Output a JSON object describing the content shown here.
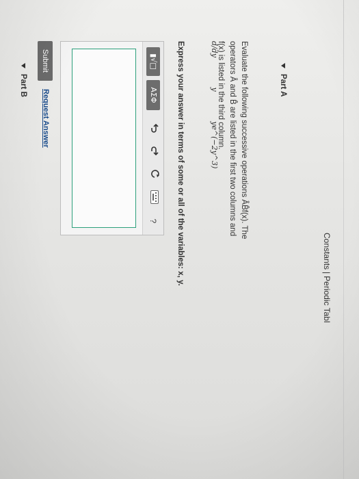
{
  "header": {
    "constants_label": "Constants",
    "separator": "|",
    "periodic_table_label": "Periodic Tabl"
  },
  "partA": {
    "label": "Part A",
    "question_text": "Evaluate the following successive operations ÂB̂f(x). The operators Â and B̂ are listed in the first two columns and f(x) is listed in the third column.",
    "operator_a": "d/dy",
    "operator_b": "y",
    "function": "ye^(−2y^3)",
    "instruction": "Express your answer in terms of some or all of the variables: x, y."
  },
  "toolbar": {
    "template_button": "▮√□",
    "greek_button": "ΑΣΦ",
    "undo_icon": "undo-icon",
    "redo_icon": "redo-icon",
    "reset_icon": "reset-icon",
    "keyboard_icon": "keyboard-icon",
    "help_label": "?"
  },
  "actions": {
    "submit_label": "Submit",
    "request_answer_label": "Request Answer"
  },
  "partB": {
    "label": "Part B"
  },
  "colors": {
    "answer_border": "#2b9f7a",
    "submit_bg": "#6b6b6b",
    "link": "#1a4c8c"
  }
}
